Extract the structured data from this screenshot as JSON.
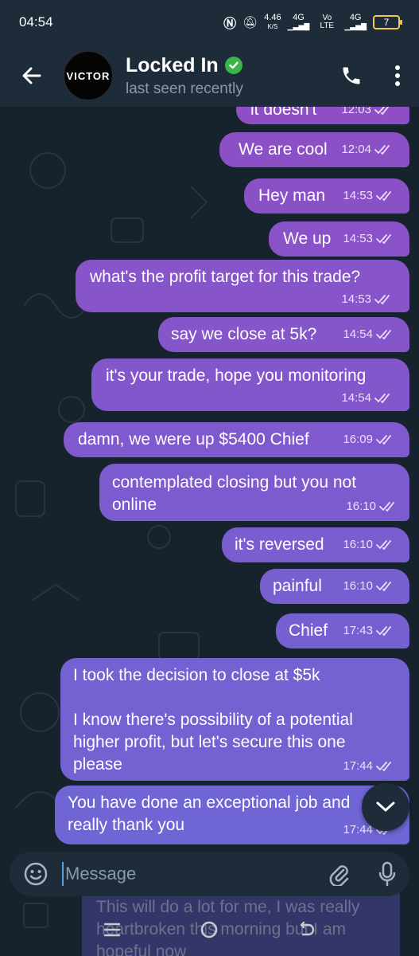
{
  "status_bar": {
    "time": "04:54",
    "net_speed": "4.46",
    "net_unit": "K/S",
    "signal1": "4G",
    "volte": "Vo LTE",
    "signal2": "4G",
    "battery": "7"
  },
  "header": {
    "title": "Locked In",
    "subtitle": "last seen recently",
    "avatar_text": "VICTOR"
  },
  "messages": [
    {
      "text": "it doesn't",
      "time": "12:03"
    },
    {
      "text": "We are cool",
      "time": "12:04"
    },
    {
      "text": "Hey man",
      "time": "14:53"
    },
    {
      "text": "We up",
      "time": "14:53"
    },
    {
      "text": "what's the profit target for this trade?",
      "time": "14:53"
    },
    {
      "text": "say we close at 5k?",
      "time": "14:54"
    },
    {
      "text": "it's your trade, hope you monitoring",
      "time": "14:54"
    },
    {
      "text": "damn, we were up $5400 Chief",
      "time": "16:09"
    },
    {
      "text": "contemplated closing but you not online",
      "time": "16:10"
    },
    {
      "text": "it's reversed",
      "time": "16:10"
    },
    {
      "text": "painful",
      "time": "16:10"
    },
    {
      "text": "Chief",
      "time": "17:43"
    },
    {
      "text": "I took the decision to close at $5k\n\nI know there's possibility of a potential higher profit, but let's secure this one please",
      "time": "17:44"
    },
    {
      "text": "You have done an exceptional job and really thank you",
      "time": "17:44"
    },
    {
      "text": "This will do a lot for me, I was really heartbroken this morning but I am hopeful now"
    }
  ],
  "composer": {
    "placeholder": "Message"
  },
  "colors": {
    "bubble_top": "#8e4fc4",
    "bubble_bottom": "#6a5fd9",
    "header_bg": "#1e2c3a",
    "chat_bg": "#16232c"
  }
}
